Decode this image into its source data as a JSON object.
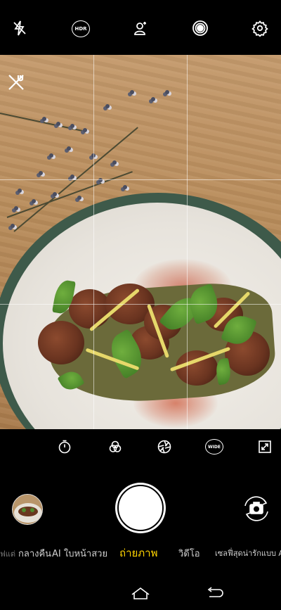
{
  "top_bar": {
    "icons": [
      "flash-off-icon",
      "hdr-icon",
      "face-beauty-icon",
      "live-photo-icon",
      "settings-icon"
    ],
    "hdr_label": "HDR"
  },
  "viewfinder": {
    "scene_icon": "food-scene-icon",
    "grid": "3x3"
  },
  "toolbar": {
    "icons": [
      "color-filter-icon",
      "timer-icon",
      "filters-icon",
      "aperture-icon",
      "wide-angle-icon",
      "aspect-ratio-icon"
    ],
    "wide_label": "WIDE"
  },
  "shutter_row": {
    "gallery_icon": "gallery-thumbnail",
    "shutter_icon": "shutter-button",
    "flip_icon": "switch-camera-icon"
  },
  "modes": {
    "items": [
      "ฟแต่",
      "กลางคืน",
      "AI ใบหน้าสวย",
      "ถ่ายภาพ",
      "วิดีโอ",
      "เซลฟี่สุดน่ารักแบบ AR"
    ],
    "active": "ถ่ายภาพ"
  },
  "colors": {
    "accent": "#ffd400",
    "background": "#000000"
  },
  "nav_bar": {
    "icons": [
      "home-icon",
      "back-icon"
    ]
  }
}
